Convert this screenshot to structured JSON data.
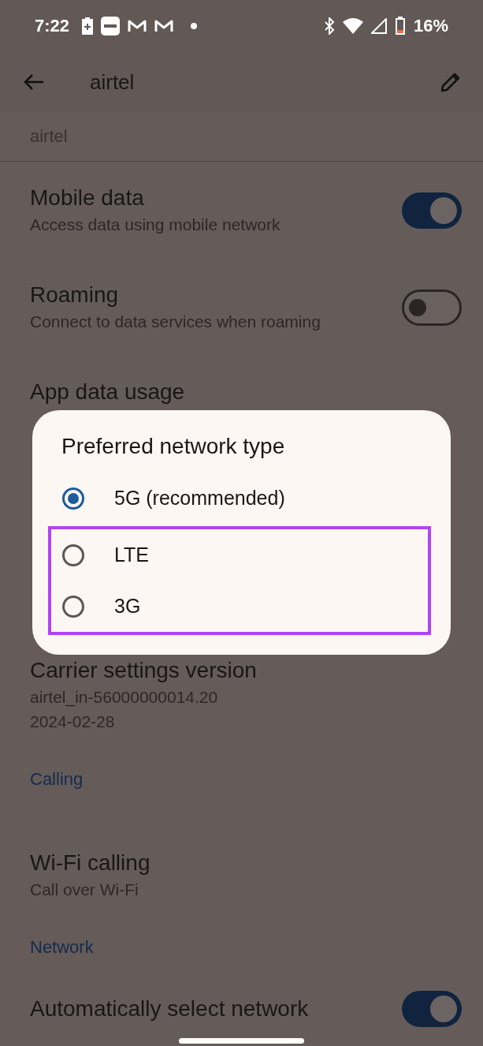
{
  "status_bar": {
    "time": "7:22",
    "battery_percent": "16%"
  },
  "toolbar": {
    "title": "airtel"
  },
  "subtitle": "airtel",
  "settings": [
    {
      "kind": "toggle",
      "title": "Mobile data",
      "subtitle": [
        "Access data using mobile network"
      ],
      "on": true
    },
    {
      "kind": "toggle",
      "title": "Roaming",
      "subtitle": [
        "Connect to data services when roaming"
      ],
      "on": false
    },
    {
      "kind": "plain",
      "title": "App data usage"
    },
    {
      "kind": "gap"
    },
    {
      "kind": "plain",
      "title": "Carrier settings version",
      "subtitle": [
        "airtel_in-56000000014.20",
        "2024-02-28"
      ]
    },
    {
      "kind": "section",
      "title": "Calling"
    },
    {
      "kind": "plain",
      "title": "Wi-Fi calling",
      "subtitle": [
        "Call over Wi-Fi"
      ]
    },
    {
      "kind": "section",
      "title": "Network"
    },
    {
      "kind": "toggle",
      "title": "Automatically select network",
      "on": true
    }
  ],
  "dialog": {
    "title": "Preferred network type",
    "options": [
      {
        "label": "5G (recommended)",
        "selected": true,
        "highlighted": false
      },
      {
        "label": "LTE",
        "selected": false,
        "highlighted": true
      },
      {
        "label": "3G",
        "selected": false,
        "highlighted": true
      }
    ]
  }
}
